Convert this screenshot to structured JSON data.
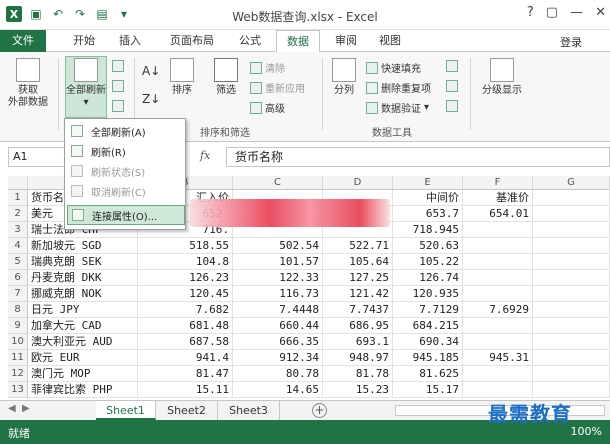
{
  "window": {
    "title": "Web数据查询.xlsx - Excel",
    "help": "?",
    "restore": "▢",
    "minimize": "—",
    "close": "✕"
  },
  "ribbon_tabs": {
    "file": "文件",
    "tabs": [
      "开始",
      "插入",
      "页面布局",
      "公式",
      "数据",
      "审阅",
      "视图"
    ],
    "active": "数据",
    "login": "登录"
  },
  "ribbon": {
    "get_external_1": "获取",
    "get_external_2": "外部数据",
    "refresh_all": "全部刷新",
    "sort": "排序",
    "filter": "筛选",
    "clear": "清除",
    "reapply": "重新应用",
    "advanced": "高级",
    "split": "分列",
    "flash_fill": "快速填充",
    "remove_dup": "删除重复项",
    "validate": "数据验证",
    "outline": "分级显示",
    "group_sort_filter": "排序和筛选",
    "group_data_tools": "数据工具"
  },
  "dropdown": {
    "items": [
      {
        "label": "全部刷新(A)",
        "disabled": false
      },
      {
        "label": "刷新(R)",
        "disabled": false
      },
      {
        "label": "刷新状态(S)",
        "disabled": true
      },
      {
        "label": "取消刷新(C)",
        "disabled": true
      },
      {
        "label": "连接属性(O)...",
        "disabled": false,
        "highlighted": true
      }
    ]
  },
  "formula_bar": {
    "cell_ref": "A1",
    "fx": "fx",
    "content": "货币名称"
  },
  "columns": [
    "A",
    "B",
    "C",
    "D",
    "E",
    "F",
    "G"
  ],
  "rows": [
    {
      "n": "1",
      "cells": [
        "货币名",
        "汇入价",
        "",
        "",
        "中间价",
        "基准价",
        ""
      ]
    },
    {
      "n": "2",
      "cells": [
        "美元",
        "652.",
        "",
        "",
        "653.7",
        "654.01",
        ""
      ]
    },
    {
      "n": "3",
      "cells": [
        "瑞士法郎 CHF",
        "716.",
        "",
        "",
        "718.945",
        "",
        ""
      ]
    },
    {
      "n": "4",
      "cells": [
        "新加坡元 SGD",
        "518.55",
        "502.54",
        "522.71",
        "520.63",
        "",
        ""
      ]
    },
    {
      "n": "5",
      "cells": [
        "瑞典克朗 SEK",
        "104.8",
        "101.57",
        "105.64",
        "105.22",
        "",
        ""
      ]
    },
    {
      "n": "6",
      "cells": [
        "丹麦克朗 DKK",
        "126.23",
        "122.33",
        "127.25",
        "126.74",
        "",
        ""
      ]
    },
    {
      "n": "7",
      "cells": [
        "挪威克朗 NOK",
        "120.45",
        "116.73",
        "121.42",
        "120.935",
        "",
        ""
      ]
    },
    {
      "n": "8",
      "cells": [
        "日元 JPY",
        "7.682",
        "7.4448",
        "7.7437",
        "7.7129",
        "7.6929",
        ""
      ]
    },
    {
      "n": "9",
      "cells": [
        "加拿大元 CAD",
        "681.48",
        "660.44",
        "686.95",
        "684.215",
        "",
        ""
      ]
    },
    {
      "n": "10",
      "cells": [
        "澳大利亚元 AUD",
        "687.58",
        "666.35",
        "693.1",
        "690.34",
        "",
        ""
      ]
    },
    {
      "n": "11",
      "cells": [
        "欧元 EUR",
        "941.4",
        "912.34",
        "948.97",
        "945.185",
        "945.31",
        ""
      ]
    },
    {
      "n": "12",
      "cells": [
        "澳门元 MOP",
        "81.47",
        "80.78",
        "81.78",
        "81.625",
        "",
        ""
      ]
    },
    {
      "n": "13",
      "cells": [
        "菲律宾比索 PHP",
        "15.11",
        "14.65",
        "15.23",
        "15.17",
        "",
        ""
      ]
    }
  ],
  "sheets": {
    "tabs": [
      "Sheet1",
      "Sheet2",
      "Sheet3"
    ],
    "active": "Sheet1",
    "add": "+"
  },
  "status": {
    "ready": "就绪",
    "zoom": "100%"
  },
  "watermark": "最需教育"
}
